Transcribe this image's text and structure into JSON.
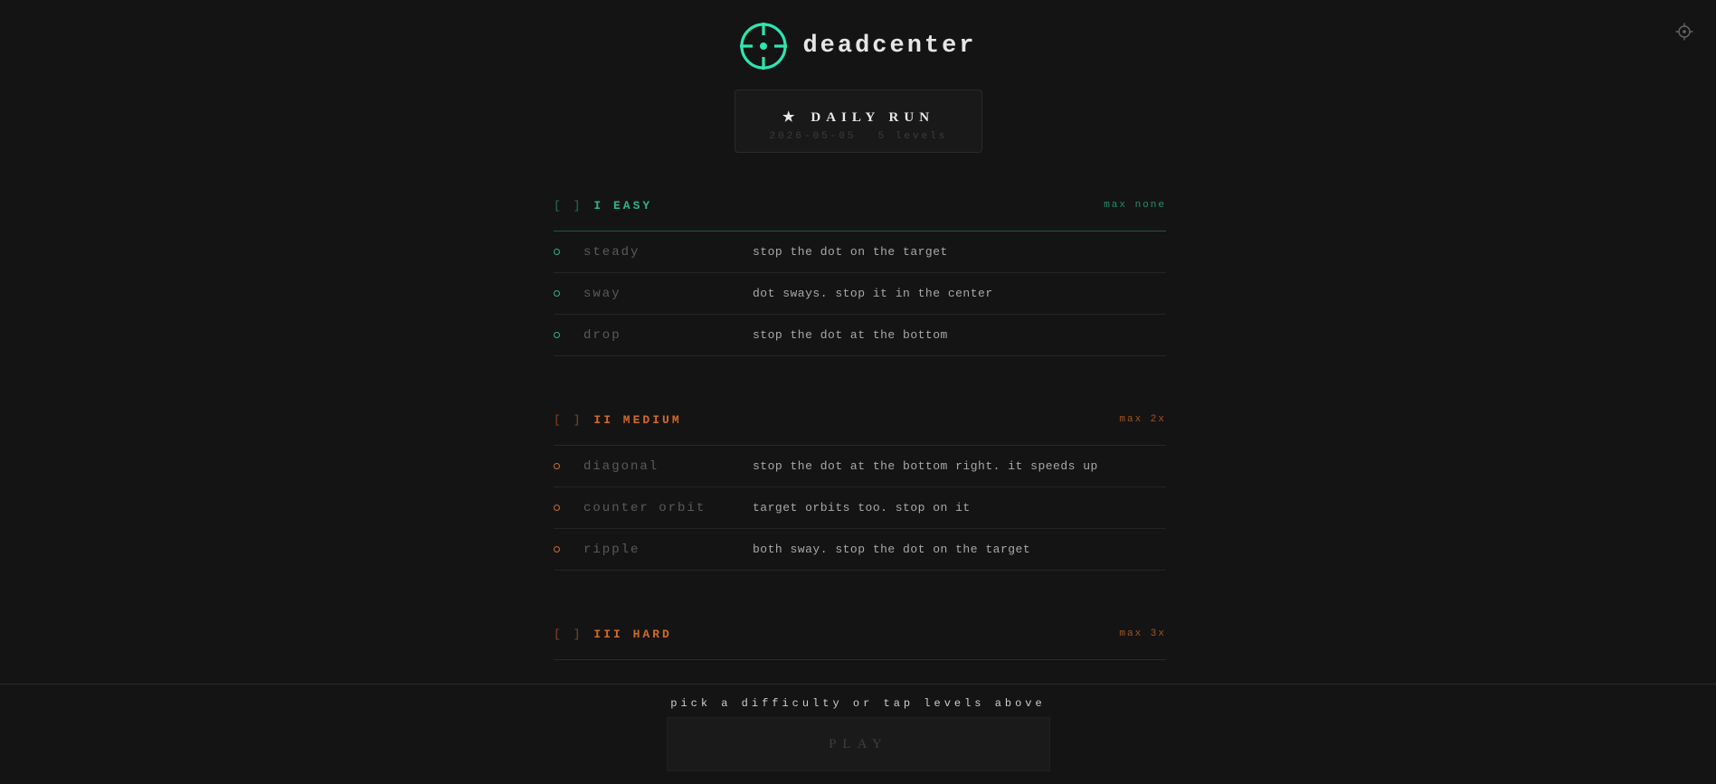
{
  "app": {
    "title": "deadcenter",
    "logo_icon": "crosshair-icon",
    "settings_icon": "gear-icon"
  },
  "colors": {
    "accent": "#2ee6b0",
    "easy": "#2fb389",
    "medium": "#d06a2a",
    "hard": "#d06a2a",
    "background": "#141414"
  },
  "daily": {
    "star": "★",
    "title": "DAILY RUN",
    "date": "2026-05-05",
    "levels": "5 levels"
  },
  "sections": [
    {
      "bracket": "[ ]",
      "name": "I EASY",
      "max": "max none",
      "levels": [
        {
          "name": "steady",
          "desc": "stop the dot on the target"
        },
        {
          "name": "sway",
          "desc": "dot sways. stop it in the center"
        },
        {
          "name": "drop",
          "desc": "stop the dot at the bottom"
        }
      ]
    },
    {
      "bracket": "[ ]",
      "name": "II MEDIUM",
      "max": "max 2x",
      "levels": [
        {
          "name": "diagonal",
          "desc": "stop the dot at the bottom right. it speeds up"
        },
        {
          "name": "counter orbit",
          "desc": "target orbits too. stop on it"
        },
        {
          "name": "ripple",
          "desc": "both sway. stop the dot on the target"
        }
      ]
    },
    {
      "bracket": "[ ]",
      "name": "III HARD",
      "max": "max 3x",
      "levels": []
    }
  ],
  "footer": {
    "hint": "pick a difficulty or tap levels above",
    "play_label": "PLAY"
  }
}
